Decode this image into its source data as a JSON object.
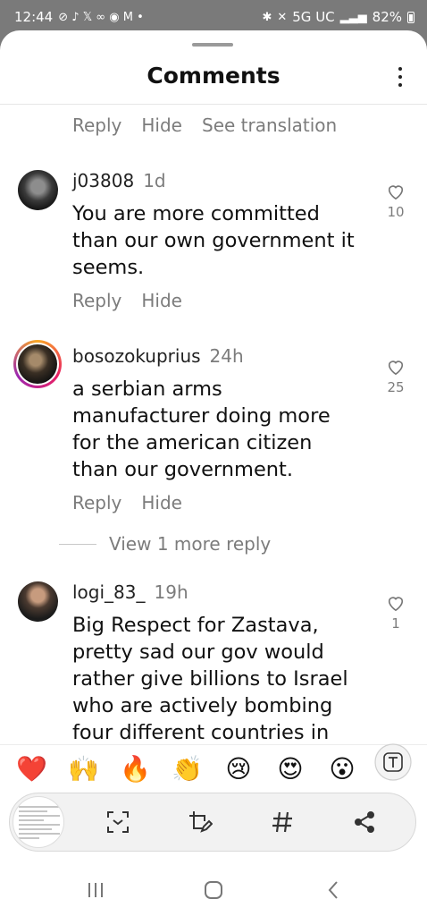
{
  "status": {
    "time": "12:44",
    "network": "5G UC",
    "battery": "82%"
  },
  "header": {
    "title": "Comments"
  },
  "prev_actions": {
    "reply": "Reply",
    "hide": "Hide",
    "translate": "See translation"
  },
  "comments": [
    {
      "username": "j03808",
      "time": "1d",
      "text": "You are more committed than our own government it seems.",
      "likes": "10",
      "reply": "Reply",
      "hide": "Hide"
    },
    {
      "username": "bosozokuprius",
      "time": "24h",
      "text": "a serbian arms manufacturer doing more for the american citizen than our government.",
      "likes": "25",
      "reply": "Reply",
      "hide": "Hide"
    },
    {
      "username": "logi_83_",
      "time": "19h",
      "text": "Big Respect for Zastava, pretty sad our gov would rather give billions to Israel who are actively bombing four different countries in",
      "likes": "1"
    }
  ],
  "view_more": "View 1 more reply",
  "emojis": [
    "❤️",
    "🙌",
    "🔥",
    "👏",
    "😢",
    "😍",
    "😮"
  ],
  "icons": {
    "text_tool": "text-format-icon",
    "toolbar": [
      "smart-select-icon",
      "edit-crop-icon",
      "hashtag-icon",
      "share-icon"
    ],
    "nav": [
      "recent-apps-icon",
      "home-icon",
      "back-icon"
    ]
  }
}
